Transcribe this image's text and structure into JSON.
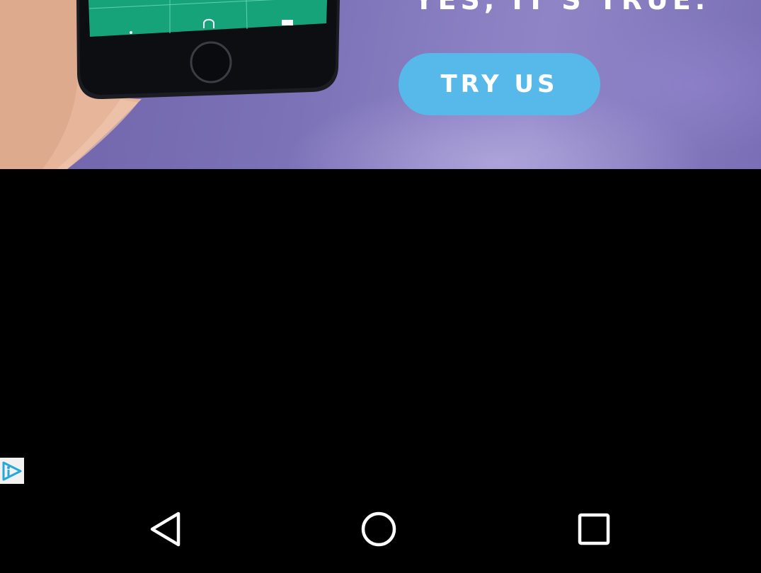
{
  "ad": {
    "headline": "YES, IT'S TRUE.",
    "cta_label": "TRY US",
    "colors": {
      "background": "#7c72b8",
      "button": "#56b9ea",
      "phone_screen": "#17a37a"
    }
  },
  "adchoices": {
    "icon": "adchoices-icon"
  },
  "nav_bar": {
    "back_icon": "back-triangle-icon",
    "home_icon": "home-circle-icon",
    "recents_icon": "recents-square-icon"
  }
}
